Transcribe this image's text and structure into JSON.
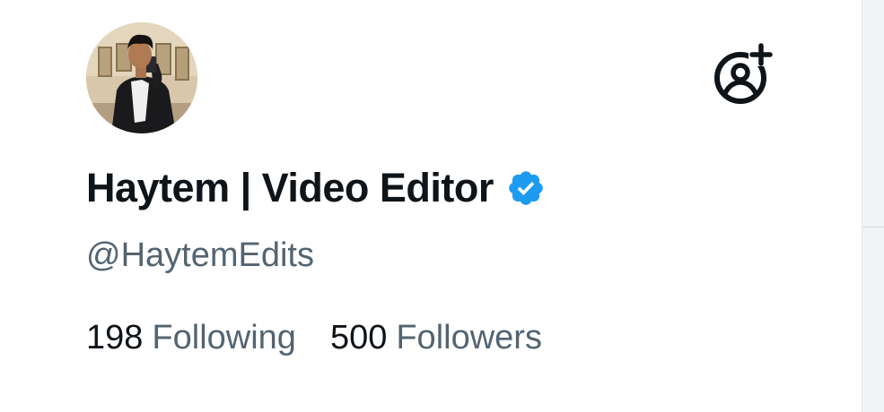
{
  "profile": {
    "display_name": "Haytem | Video Editor",
    "handle": "@HaytemEdits",
    "verified": true,
    "verified_badge_icon": "verified-badge-icon",
    "avatar_icon": "profile-photo"
  },
  "actions": {
    "follow_icon": "add-user-icon"
  },
  "stats": {
    "following_count": "198",
    "following_label": "Following",
    "followers_count": "500",
    "followers_label": "Followers"
  },
  "colors": {
    "text_primary": "#0f1419",
    "text_secondary": "#536471",
    "verified_blue": "#1d9bf0",
    "background": "#ffffff"
  }
}
